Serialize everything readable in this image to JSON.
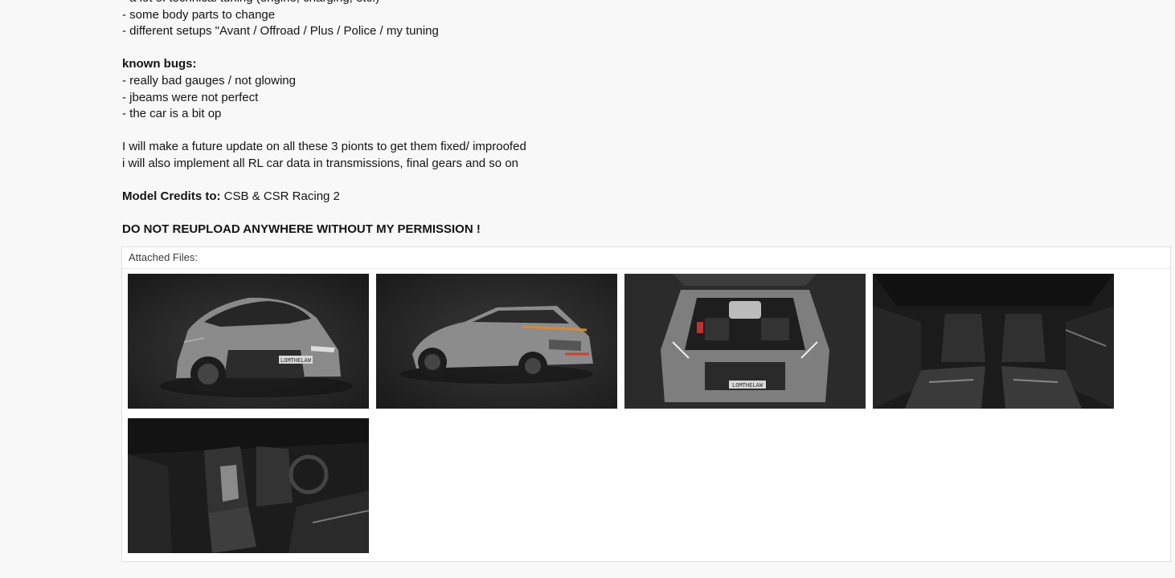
{
  "post": {
    "lines": [
      "- a lot of technical tuning (engine, charging, etc.)",
      "- some body parts to change",
      "- different setups \"Avant / Offroad / Plus / Police / my tuning"
    ],
    "known_bugs_label": "known bugs:",
    "bugs": [
      "- really bad gauges / not glowing",
      "- jbeams were not perfect",
      "- the car is a bit op"
    ],
    "update_lines": [
      "I will make a future update on all these 3 pionts to get them fixed/ improofed",
      "i will also implement all RL car data in transmissions, final gears and so on"
    ],
    "credits_label": "Model Credits to:",
    "credits_value": " CSB & CSR Racing 2",
    "warning": "DO NOT REUPLOAD ANYWHERE WITHOUT MY PERMISSION !"
  },
  "attachments": {
    "header": "Attached Files:",
    "files": [
      {
        "name": "car-front-three-quarter",
        "plate": "LOMTHELAW"
      },
      {
        "name": "car-rear-three-quarter"
      },
      {
        "name": "engine-bay",
        "plate": "LOMTHELAW"
      },
      {
        "name": "interior-rear-seats"
      },
      {
        "name": "interior-front-seats"
      }
    ]
  },
  "colors": {
    "page_bg": "#f8f8f8",
    "panel_bg": "#ffffff",
    "panel_border": "#dfdfdf",
    "thumb_bg": "#2a2a2a"
  }
}
